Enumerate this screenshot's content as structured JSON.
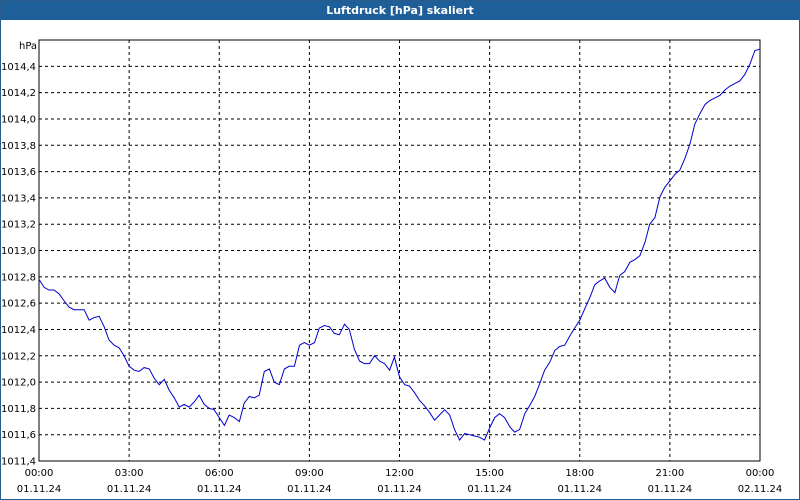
{
  "window": {
    "title": "Luftdruck [hPa] skaliert"
  },
  "chart_data": {
    "type": "line",
    "title": "Luftdruck [hPa] skaliert",
    "ylabel": "hPa",
    "xlabel": "",
    "xlim_hours": [
      0,
      24
    ],
    "ylim": [
      1011.4,
      1014.6
    ],
    "grid": true,
    "line_color": "#0000cc",
    "y_ticks": [
      "1011,4",
      "1011,6",
      "1011,8",
      "1012,0",
      "1012,2",
      "1012,4",
      "1012,6",
      "1012,8",
      "1013,0",
      "1013,2",
      "1013,4",
      "1013,6",
      "1013,8",
      "1014,0",
      "1014,2",
      "1014,4"
    ],
    "x_ticks": [
      {
        "time": "00:00",
        "date": "01.11.24"
      },
      {
        "time": "03:00",
        "date": "01.11.24"
      },
      {
        "time": "06:00",
        "date": "01.11.24"
      },
      {
        "time": "09:00",
        "date": "01.11.24"
      },
      {
        "time": "12:00",
        "date": "01.11.24"
      },
      {
        "time": "15:00",
        "date": "01.11.24"
      },
      {
        "time": "18:00",
        "date": "01.11.24"
      },
      {
        "time": "21:00",
        "date": "01.11.24"
      },
      {
        "time": "00:00",
        "date": "02.11.24"
      }
    ],
    "series": [
      {
        "x": [
          0.0,
          0.17,
          0.33,
          0.5,
          0.67,
          0.83,
          1.0,
          1.17,
          1.33,
          1.5,
          1.67,
          1.83,
          2.0,
          2.17,
          2.33,
          2.5,
          2.67,
          2.83,
          3.0,
          3.17,
          3.33,
          3.5,
          3.67,
          3.83,
          4.0,
          4.17,
          4.33,
          4.5,
          4.67,
          4.83,
          5.0,
          5.17,
          5.33,
          5.5,
          5.67,
          5.83,
          6.0,
          6.17,
          6.33,
          6.5,
          6.67,
          6.83,
          7.0,
          7.17,
          7.33,
          7.5,
          7.67,
          7.83,
          8.0,
          8.17,
          8.33,
          8.5,
          8.67,
          8.83,
          9.0,
          9.17,
          9.33,
          9.5,
          9.67,
          9.83,
          10.0,
          10.17,
          10.33,
          10.5,
          10.67,
          10.83,
          11.0,
          11.17,
          11.33,
          11.5,
          11.67,
          11.83,
          12.0,
          12.17,
          12.33,
          12.5,
          12.67,
          12.83,
          13.0,
          13.17,
          13.33,
          13.5,
          13.67,
          13.83,
          14.0,
          14.17,
          14.33,
          14.5,
          14.67,
          14.83,
          15.0,
          15.17,
          15.33,
          15.5,
          15.67,
          15.83,
          16.0,
          16.17,
          16.33,
          16.5,
          16.67,
          16.83,
          17.0,
          17.17,
          17.33,
          17.5,
          17.67,
          17.83,
          18.0,
          18.17,
          18.33,
          18.5,
          18.67,
          18.83,
          19.0,
          19.17,
          19.33,
          19.5,
          19.67,
          19.83,
          20.0,
          20.17,
          20.33,
          20.5,
          20.67,
          20.83,
          21.0,
          21.17,
          21.33,
          21.5,
          21.67,
          21.83,
          22.0,
          22.17,
          22.33,
          22.5,
          22.67,
          22.83,
          23.0,
          23.17,
          23.33,
          23.5,
          23.67,
          23.83,
          24.0
        ],
        "values": [
          1012.78,
          1012.72,
          1012.7,
          1012.7,
          1012.67,
          1012.62,
          1012.57,
          1012.55,
          1012.55,
          1012.55,
          1012.47,
          1012.49,
          1012.5,
          1012.42,
          1012.32,
          1012.28,
          1012.26,
          1012.2,
          1012.12,
          1012.09,
          1012.08,
          1012.11,
          1012.1,
          1012.03,
          1011.98,
          1012.02,
          1011.94,
          1011.88,
          1011.81,
          1011.83,
          1011.81,
          1011.85,
          1011.9,
          1011.83,
          1011.8,
          1011.79,
          1011.73,
          1011.67,
          1011.75,
          1011.73,
          1011.7,
          1011.84,
          1011.89,
          1011.88,
          1011.9,
          1012.08,
          1012.1,
          1012.0,
          1011.98,
          1012.1,
          1012.12,
          1012.12,
          1012.28,
          1012.3,
          1012.28,
          1012.3,
          1012.41,
          1012.43,
          1012.42,
          1012.37,
          1012.36,
          1012.44,
          1012.4,
          1012.25,
          1012.16,
          1012.14,
          1012.14,
          1012.2,
          1012.16,
          1012.14,
          1012.09,
          1012.19,
          1012.04,
          1011.98,
          1011.97,
          1011.92,
          1011.86,
          1011.82,
          1011.77,
          1011.71,
          1011.75,
          1011.79,
          1011.75,
          1011.64,
          1011.56,
          1011.61,
          1011.6,
          1011.59,
          1011.58,
          1011.56,
          1011.65,
          1011.73,
          1011.76,
          1011.73,
          1011.66,
          1011.62,
          1011.64,
          1011.76,
          1011.82,
          1011.89,
          1011.99,
          1012.09,
          1012.15,
          1012.24,
          1012.27,
          1012.28,
          1012.35,
          1012.41,
          1012.47,
          1012.56,
          1012.64,
          1012.74,
          1012.77,
          1012.79,
          1012.72,
          1012.68,
          1012.81,
          1012.84,
          1012.91,
          1012.93,
          1012.96,
          1013.06,
          1013.2,
          1013.25,
          1013.41,
          1013.48,
          1013.53,
          1013.58,
          1013.61,
          1013.7,
          1013.81,
          1013.96,
          1014.04,
          1014.11,
          1014.14,
          1014.16,
          1014.18,
          1014.22,
          1014.25,
          1014.27,
          1014.29,
          1014.34,
          1014.42,
          1014.52,
          1014.53
        ]
      }
    ]
  }
}
